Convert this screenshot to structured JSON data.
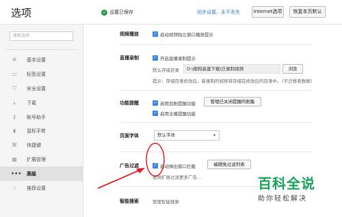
{
  "header": {
    "title": "选项",
    "saved_status": "设置已保存",
    "sync_text": "同步设置，永不丢失",
    "internet_options_label": "Internet选项",
    "restore_label": "恢复本页默认"
  },
  "sidebar": {
    "search_placeholder": "搜索选项",
    "items": [
      {
        "label": "基本设置",
        "icon": "gear-icon"
      },
      {
        "label": "标签设置",
        "icon": "tab-icon"
      },
      {
        "label": "安全设置",
        "icon": "shield-icon"
      },
      {
        "label": "下载",
        "icon": "download-icon"
      },
      {
        "label": "帐号助手",
        "icon": "key-icon"
      },
      {
        "label": "鼠标手势",
        "icon": "mouse-icon"
      },
      {
        "label": "快捷键",
        "icon": "shortcut-icon"
      },
      {
        "label": "扩展管理",
        "icon": "puzzle-icon"
      },
      {
        "label": "高级",
        "icon": "more-icon",
        "active": true
      },
      {
        "label": "推荐设置",
        "icon": "thumb-icon"
      }
    ]
  },
  "main": {
    "video": {
      "label": "视频播放",
      "option": "启动视频独立窗口播放提示"
    },
    "live_record": {
      "label": "直播录制",
      "option": "开启直播录制提示",
      "dir_label": "默认存储目录",
      "dir_value": "D:\\搜狗高速下载\\已录制视频",
      "browse_label": "浏览",
      "hint": "提示：存储目录修改后，新录制的视频将存储在修改后的目录中。（不迁移老数据）"
    },
    "feature_reminder": {
      "label": "功能提醒",
      "option1": "启用追剧提醒功能",
      "manage_label": "管理已关闭提醒的剧集",
      "option2": "启用主播提醒功能"
    },
    "page_font": {
      "label": "页面字体",
      "value": "默认字体"
    },
    "ad_filter": {
      "label": "广告过滤",
      "option": "启动弹出窗口拦截",
      "edit_label": "编辑免过滤列表",
      "more": "使用扩展过滤更多广告..."
    },
    "smart_search": {
      "label": "智能搜索",
      "manage": "管理智能搜索"
    }
  },
  "annotation": {
    "circle_color": "#e02020",
    "arrow_color": "#e02020"
  },
  "watermark": {
    "brand": "百科全说",
    "slogan": "助你轻松解决"
  }
}
